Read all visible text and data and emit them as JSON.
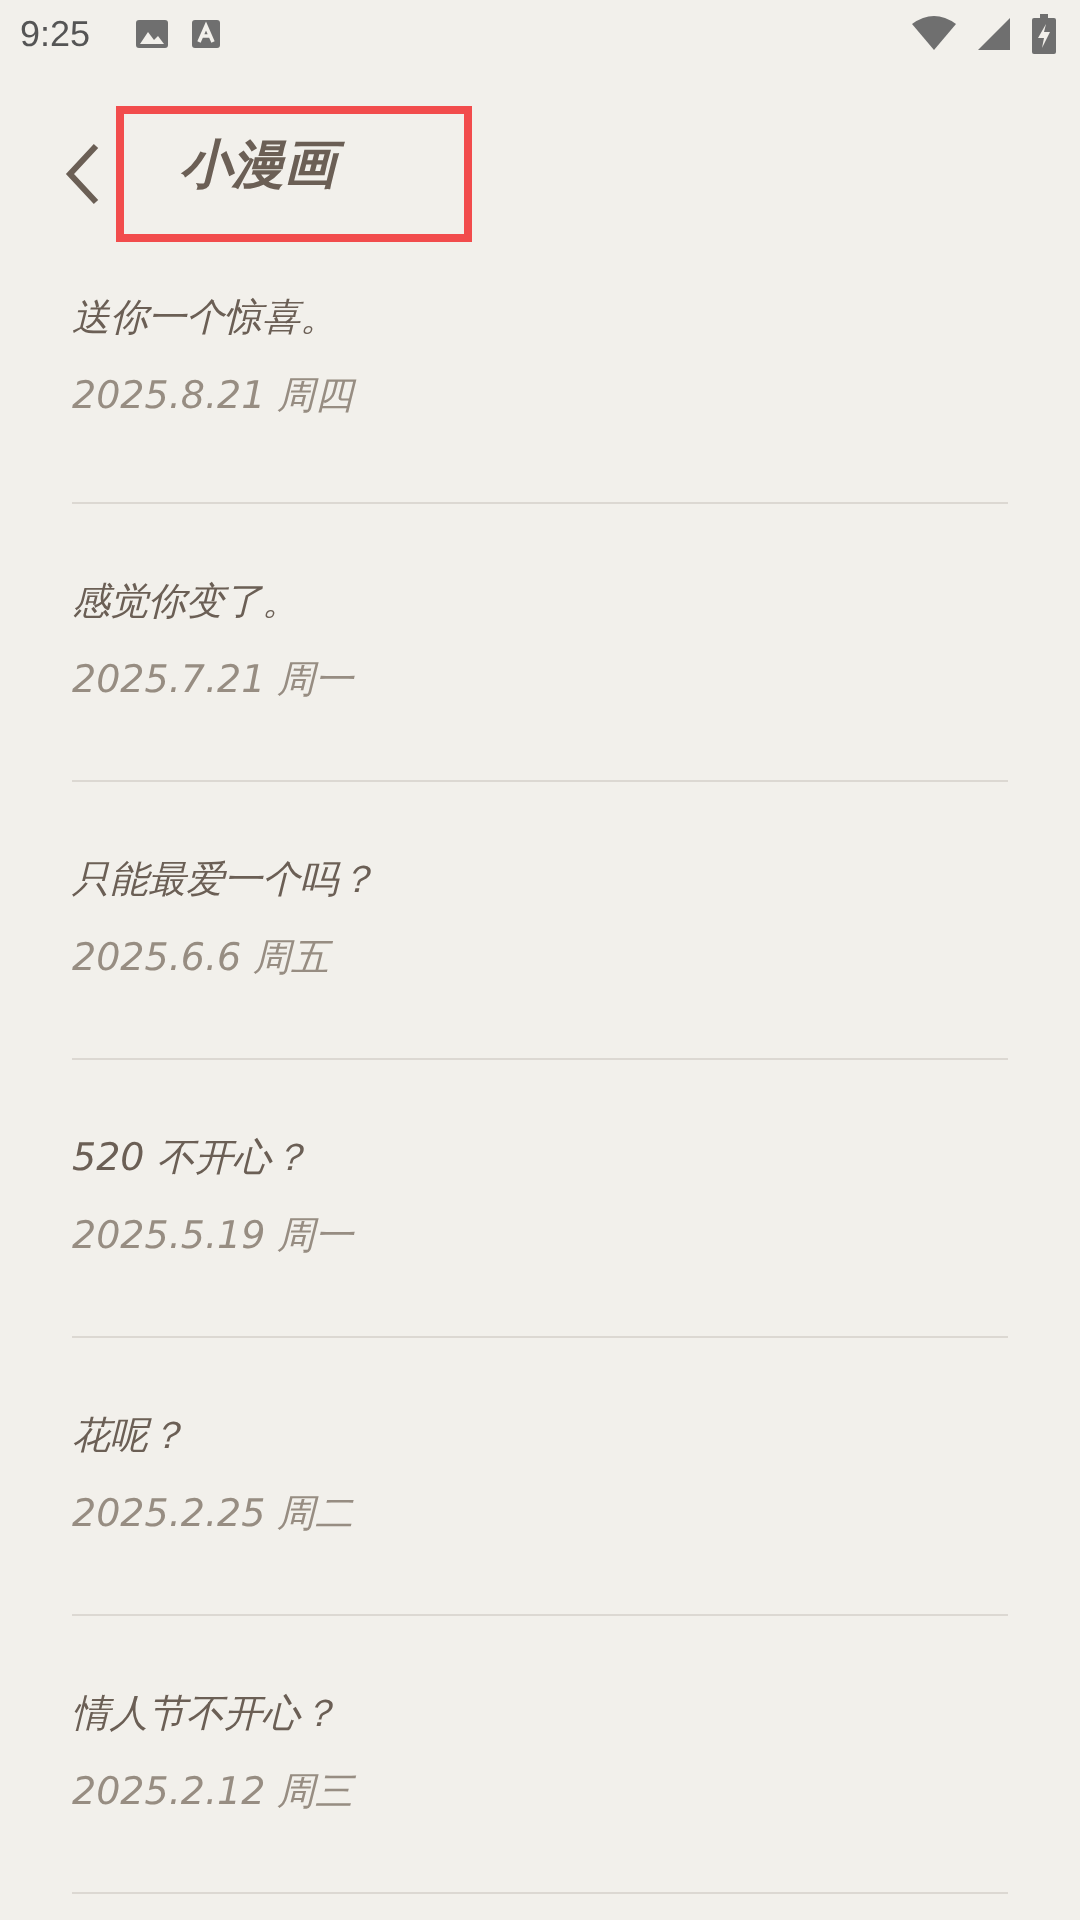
{
  "status_bar": {
    "time": "9:25"
  },
  "header": {
    "title": "小漫画",
    "highlighted": true
  },
  "items": [
    {
      "title": "送你一个惊喜。",
      "date": "2025.8.21 周四"
    },
    {
      "title": "感觉你变了。",
      "date": "2025.7.21 周一"
    },
    {
      "title": "只能最爱一个吗？",
      "date": "2025.6.6 周五"
    },
    {
      "title": "520 不开心？",
      "date": "2025.5.19 周一"
    },
    {
      "title": "花呢？",
      "date": "2025.2.25 周二"
    },
    {
      "title": "情人节不开心？",
      "date": "2025.2.12 周三"
    }
  ]
}
